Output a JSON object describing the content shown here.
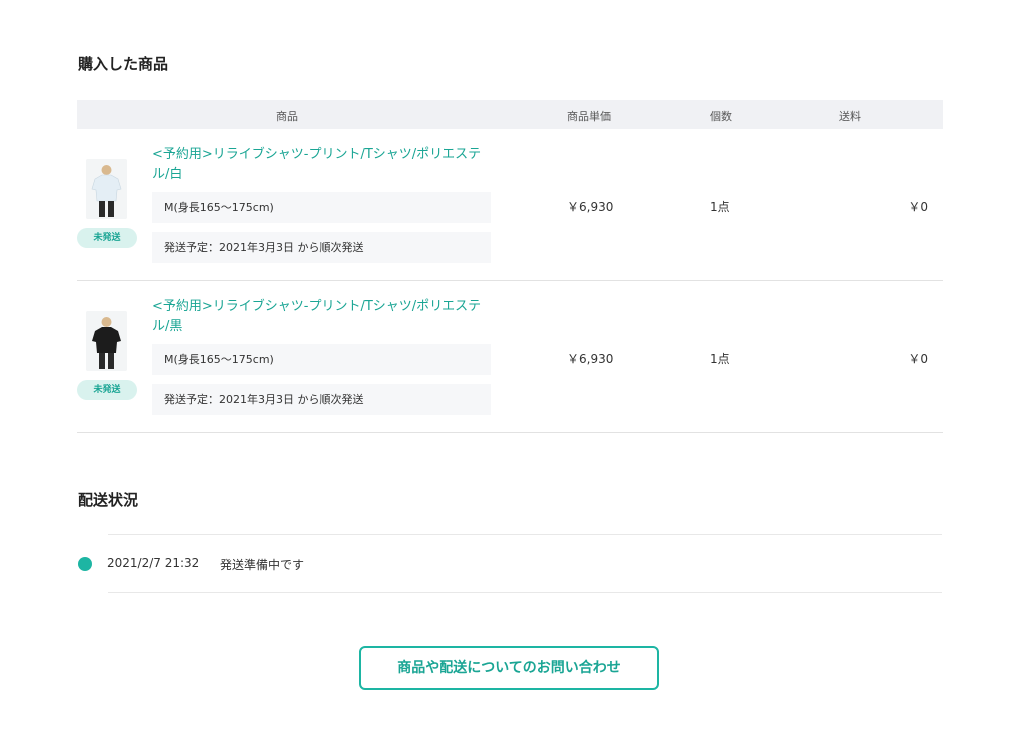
{
  "purchased": {
    "title": "購入した商品",
    "headers": {
      "product": "商品",
      "unit_price": "商品単価",
      "quantity": "個数",
      "shipping": "送料"
    },
    "items": [
      {
        "name": "<予約用>リライブシャツ-プリント/Tシャツ/ポリエステル/白",
        "badge": "未発送",
        "option": "M(身長165〜175cm)",
        "schedule": "発送予定：2021年3月3日 から順次発送",
        "price": "￥6,930",
        "quantity": "1点",
        "shipping_fee": "￥0",
        "shirt_color": "#e4eef5"
      },
      {
        "name": "<予約用>リライブシャツ-プリント/Tシャツ/ポリエステル/黒",
        "badge": "未発送",
        "option": "M(身長165〜175cm)",
        "schedule": "発送予定：2021年3月3日 から順次発送",
        "price": "￥6,930",
        "quantity": "1点",
        "shipping_fee": "￥0",
        "shirt_color": "#1c1c1c"
      }
    ]
  },
  "shipping_status": {
    "title": "配送状況",
    "entries": [
      {
        "datetime": "2021/2/7 21:32",
        "status": "発送準備中です"
      }
    ]
  },
  "contact_button": "商品や配送についてのお問い合わせ",
  "colors": {
    "accent": "#1db5a3",
    "accent_text": "#1aa594",
    "badge_bg": "#d9f2ee",
    "header_bg": "#f0f1f4"
  }
}
